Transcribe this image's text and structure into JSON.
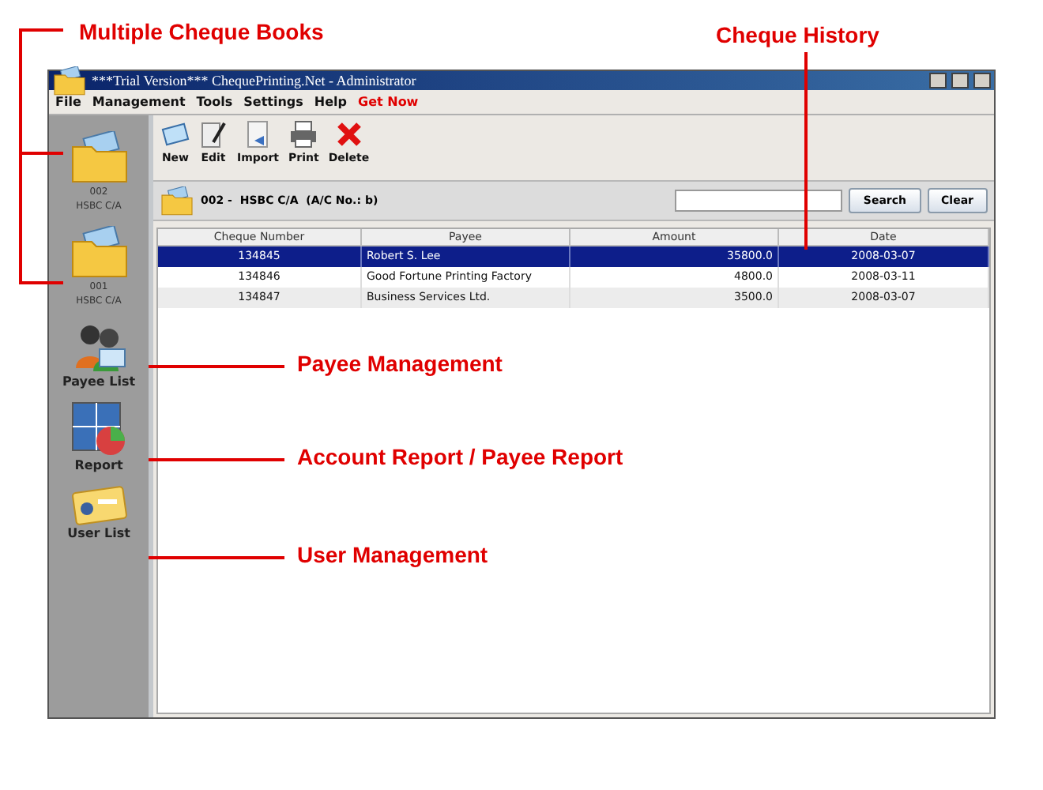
{
  "window": {
    "title": "***Trial Version*** ChequePrinting.Net - Administrator"
  },
  "menu": [
    {
      "label": "File",
      "kind": "normal"
    },
    {
      "label": "Management",
      "kind": "normal"
    },
    {
      "label": "Tools",
      "kind": "normal"
    },
    {
      "label": "Settings",
      "kind": "normal"
    },
    {
      "label": "Help",
      "kind": "normal"
    },
    {
      "label": "Get Now",
      "kind": "promo"
    }
  ],
  "sidebar": {
    "items": [
      {
        "kind": "folder",
        "lines": [
          "002",
          "HSBC C/A"
        ]
      },
      {
        "kind": "folder",
        "lines": [
          "001",
          "HSBC C/A"
        ]
      },
      {
        "kind": "payees",
        "lines": [
          "Payee List"
        ]
      },
      {
        "kind": "report",
        "lines": [
          "Report"
        ]
      },
      {
        "kind": "users",
        "lines": [
          "User List"
        ]
      }
    ]
  },
  "toolbar": [
    {
      "label": "New",
      "kind": "new"
    },
    {
      "label": "Edit",
      "kind": "edit"
    },
    {
      "label": "Import",
      "kind": "import"
    },
    {
      "label": "Print",
      "kind": "print"
    },
    {
      "label": "Delete",
      "kind": "delete"
    }
  ],
  "account": {
    "number": "002 -",
    "name": "HSBC C/A",
    "detail": "(A/C No.: b)"
  },
  "search": {
    "button": "Search",
    "clear": "Clear"
  },
  "table": {
    "columns": [
      "Cheque Number",
      "Payee",
      "Amount",
      "Date"
    ],
    "rows": [
      {
        "cells": [
          "134845",
          "Robert S. Lee",
          "35800.0",
          "2008-03-07"
        ],
        "selected": true
      },
      {
        "cells": [
          "134846",
          "Good Fortune Printing Factory",
          "4800.0",
          "2008-03-11"
        ],
        "selected": false
      },
      {
        "cells": [
          "134847",
          "Business Services Ltd.",
          "3500.0",
          "2008-03-07"
        ],
        "selected": false
      }
    ]
  },
  "callouts": [
    {
      "text": "Multiple Cheque Books",
      "kind": "bracket"
    },
    {
      "text": "Cheque History",
      "kind": "down"
    },
    {
      "text": "Payee Management",
      "kind": "left"
    },
    {
      "text": "Account Report / Payee Report",
      "kind": "left"
    },
    {
      "text": "User Management",
      "kind": "left"
    }
  ]
}
